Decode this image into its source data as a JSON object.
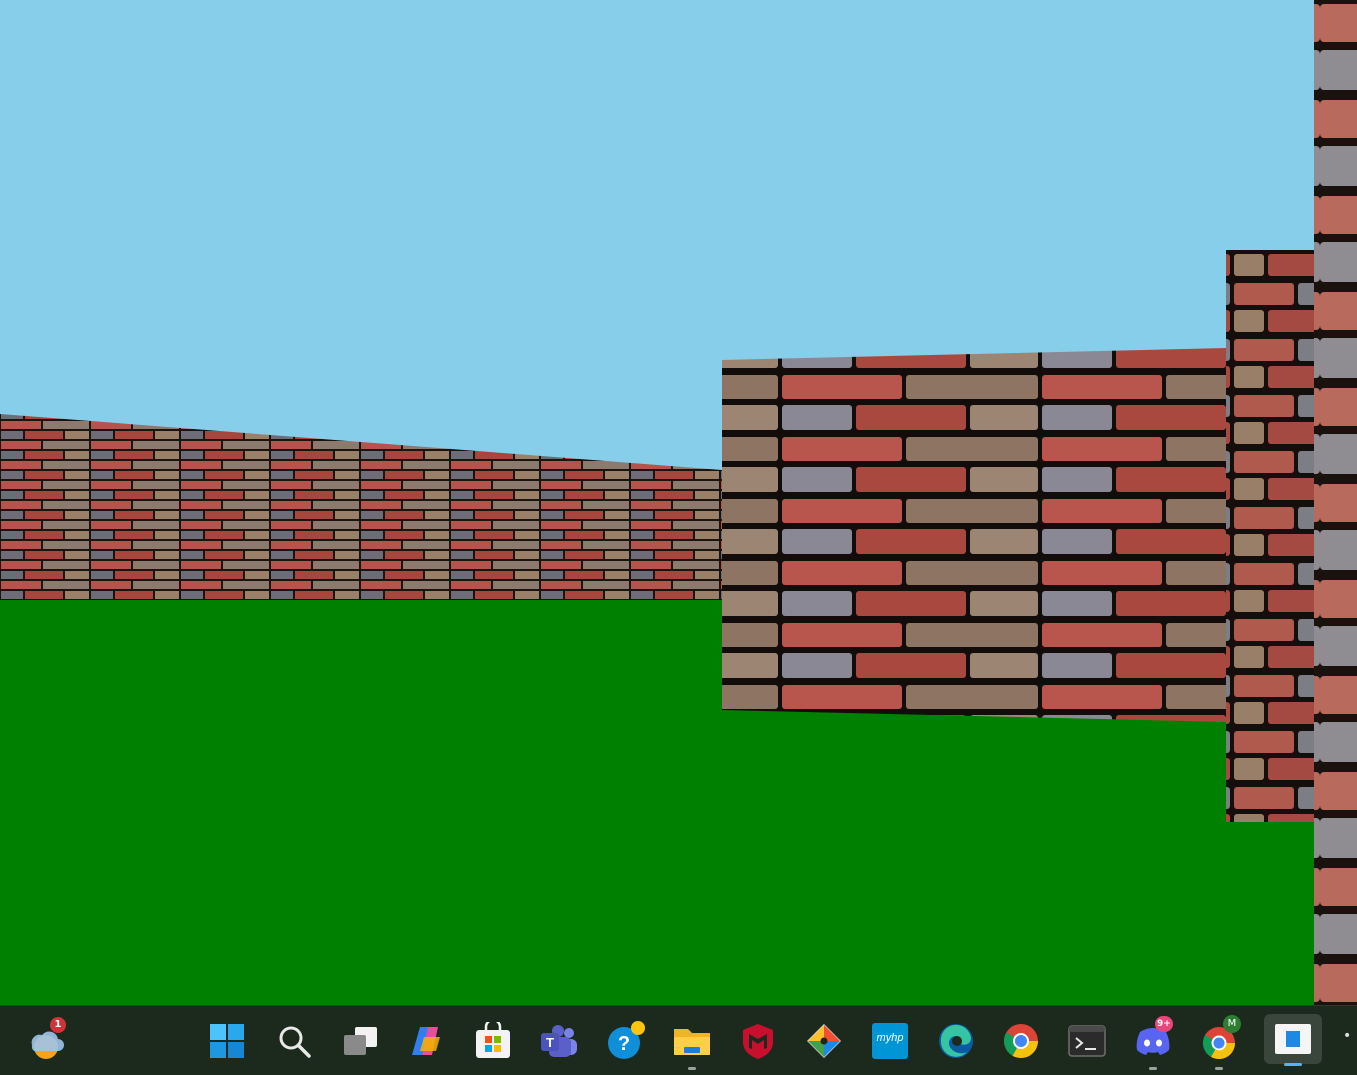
{
  "scene": {
    "sky_color": "#87ceeb",
    "ground_color": "#008000",
    "walls": [
      {
        "name": "left-far-wall",
        "texture": "brick"
      },
      {
        "name": "center-wall",
        "texture": "brick"
      },
      {
        "name": "right-near-wall",
        "texture": "brick"
      },
      {
        "name": "right-edge-wall",
        "texture": "brick"
      }
    ]
  },
  "taskbar": {
    "weather_badge": "1",
    "items": [
      {
        "name": "start-button",
        "icon": "windows-logo-icon"
      },
      {
        "name": "search-button",
        "icon": "search-icon"
      },
      {
        "name": "task-view-button",
        "icon": "task-view-icon"
      },
      {
        "name": "copilot-button",
        "icon": "copilot-icon"
      },
      {
        "name": "store-button",
        "icon": "microsoft-store-icon"
      },
      {
        "name": "teams-button",
        "icon": "teams-icon"
      },
      {
        "name": "get-help-button",
        "icon": "help-icon"
      },
      {
        "name": "file-explorer-button",
        "icon": "folder-icon"
      },
      {
        "name": "mcafee-button",
        "icon": "mcafee-icon"
      },
      {
        "name": "git-button",
        "icon": "git-icon"
      },
      {
        "name": "myhp-button",
        "icon": "myhp-icon"
      },
      {
        "name": "edge-button",
        "icon": "edge-icon"
      },
      {
        "name": "chrome-button",
        "icon": "chrome-icon"
      },
      {
        "name": "terminal-button",
        "icon": "terminal-icon"
      },
      {
        "name": "discord-button",
        "icon": "discord-icon"
      },
      {
        "name": "chrome-profile-button",
        "icon": "chrome-icon"
      },
      {
        "name": "active-app-button",
        "icon": "app-window-icon"
      }
    ],
    "discord_badge": "9+",
    "chrome_profile_badge": "M",
    "myhp_label": "myhp"
  }
}
